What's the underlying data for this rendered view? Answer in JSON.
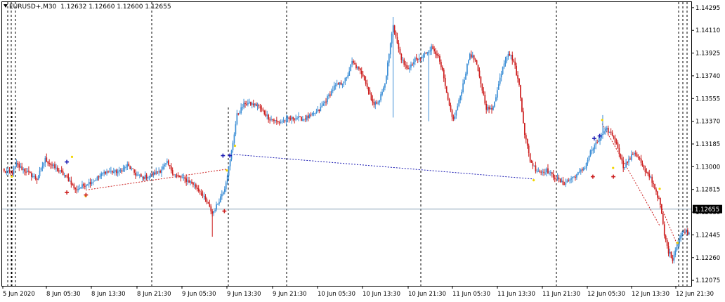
{
  "header": {
    "symbol": "EURUSD+,M30",
    "ohlc": "1.12632 1.12660 1.12600 1.12655"
  },
  "colors": {
    "bull": "#3d8fd6",
    "bear": "#cc1f1f",
    "grid": "#000000",
    "bid_line": "#8aa3b8",
    "price_box": "#000000",
    "price_box_text": "#ffffff",
    "marker_yellow": "#f2d600",
    "arrow_blue": "#1b1bb3",
    "arrow_red": "#cc1f1f"
  },
  "chart_data": {
    "type": "candlestick",
    "price_ticks": [
      "1.14295",
      "1.14110",
      "1.13925",
      "1.13740",
      "1.13555",
      "1.13370",
      "1.13185",
      "1.13000",
      "1.12815",
      "1.12630",
      "1.12445",
      "1.12260",
      "1.12075"
    ],
    "price_range": [
      1.1203,
      1.1434
    ],
    "current_price": "1.12655",
    "time_ticks": [
      "5 Jun 2020",
      "8 Jun 05:30",
      "8 Jun 13:30",
      "8 Jun 21:30",
      "9 Jun 05:30",
      "9 Jun 13:30",
      "9 Jun 21:30",
      "10 Jun 05:30",
      "10 Jun 13:30",
      "10 Jun 21:30",
      "11 Jun 05:30",
      "11 Jun 13:30",
      "11 Jun 21:30",
      "12 Jun 05:30",
      "12 Jun 13:30",
      "12 Jun 21:30"
    ],
    "close_anchors": [
      [
        0,
        1.1296
      ],
      [
        6,
        1.1295
      ],
      [
        9,
        1.1302
      ],
      [
        11,
        1.13
      ],
      [
        15,
        1.1297
      ],
      [
        24,
        1.129
      ],
      [
        30,
        1.1306
      ],
      [
        36,
        1.13
      ],
      [
        44,
        1.1293
      ],
      [
        49,
        1.1287
      ],
      [
        52,
        1.1281
      ],
      [
        60,
        1.1286
      ],
      [
        66,
        1.1289
      ],
      [
        74,
        1.1296
      ],
      [
        84,
        1.1296
      ],
      [
        90,
        1.1301
      ],
      [
        96,
        1.1294
      ],
      [
        101,
        1.1291
      ],
      [
        107,
        1.1293
      ],
      [
        114,
        1.1297
      ],
      [
        119,
        1.1303
      ],
      [
        124,
        1.1294
      ],
      [
        131,
        1.129
      ],
      [
        137,
        1.1287
      ],
      [
        143,
        1.128
      ],
      [
        148,
        1.1271
      ],
      [
        152,
        1.1262
      ],
      [
        155,
        1.1268
      ],
      [
        161,
        1.1283
      ],
      [
        165,
        1.1305
      ],
      [
        170,
        1.1342
      ],
      [
        176,
        1.1352
      ],
      [
        185,
        1.135
      ],
      [
        193,
        1.134
      ],
      [
        200,
        1.1336
      ],
      [
        206,
        1.1338
      ],
      [
        212,
        1.134
      ],
      [
        218,
        1.1339
      ],
      [
        224,
        1.1341
      ],
      [
        230,
        1.1346
      ],
      [
        236,
        1.1356
      ],
      [
        241,
        1.1365
      ],
      [
        246,
        1.1368
      ],
      [
        250,
        1.1372
      ],
      [
        254,
        1.1385
      ],
      [
        258,
        1.138
      ],
      [
        262,
        1.1375
      ],
      [
        266,
        1.1362
      ],
      [
        270,
        1.135
      ],
      [
        274,
        1.1355
      ],
      [
        278,
        1.1367
      ],
      [
        281,
        1.1392
      ],
      [
        284,
        1.1416
      ],
      [
        288,
        1.1395
      ],
      [
        292,
        1.1382
      ],
      [
        296,
        1.138
      ],
      [
        300,
        1.1387
      ],
      [
        304,
        1.1388
      ],
      [
        308,
        1.1393
      ],
      [
        312,
        1.1397
      ],
      [
        316,
        1.1392
      ],
      [
        320,
        1.1377
      ],
      [
        324,
        1.1353
      ],
      [
        328,
        1.1338
      ],
      [
        332,
        1.1353
      ],
      [
        336,
        1.1372
      ],
      [
        340,
        1.1392
      ],
      [
        344,
        1.1386
      ],
      [
        348,
        1.1368
      ],
      [
        352,
        1.1348
      ],
      [
        356,
        1.1346
      ],
      [
        360,
        1.1362
      ],
      [
        364,
        1.1382
      ],
      [
        368,
        1.1393
      ],
      [
        372,
        1.1386
      ],
      [
        376,
        1.1366
      ],
      [
        380,
        1.1327
      ],
      [
        384,
        1.1305
      ],
      [
        388,
        1.1298
      ],
      [
        392,
        1.1296
      ],
      [
        396,
        1.1297
      ],
      [
        400,
        1.1293
      ],
      [
        404,
        1.129
      ],
      [
        408,
        1.1286
      ],
      [
        412,
        1.1289
      ],
      [
        416,
        1.1292
      ],
      [
        420,
        1.1295
      ],
      [
        424,
        1.13
      ],
      [
        428,
        1.1312
      ],
      [
        432,
        1.1318
      ],
      [
        436,
        1.1325
      ],
      [
        440,
        1.133
      ],
      [
        444,
        1.1326
      ],
      [
        448,
        1.1316
      ],
      [
        452,
        1.13
      ],
      [
        456,
        1.1305
      ],
      [
        460,
        1.1312
      ],
      [
        464,
        1.1306
      ],
      [
        468,
        1.1295
      ],
      [
        472,
        1.1291
      ],
      [
        476,
        1.128
      ],
      [
        479,
        1.1269
      ],
      [
        482,
        1.1244
      ],
      [
        485,
        1.1231
      ],
      [
        488,
        1.1225
      ],
      [
        491,
        1.1236
      ],
      [
        494,
        1.1244
      ],
      [
        497,
        1.1248
      ],
      [
        500,
        1.1246
      ]
    ],
    "separators": [
      "5 Jun 2020",
      "8 Jun 05:30",
      "8 Jun 13:30",
      "8 Jun 21:30",
      "9 Jun 13:30",
      "10 Jun 21:30",
      "11 Jun 21:30",
      "12 Jun 21:30"
    ],
    "trend_lines": [
      {
        "color": "red",
        "from": [
          60,
          1.1281
        ],
        "to": [
          163,
          1.1298
        ]
      },
      {
        "color": "navy",
        "from": [
          168,
          1.131
        ],
        "to": [
          387,
          1.129
        ]
      },
      {
        "color": "red",
        "from": [
          437,
          1.1335
        ],
        "to": [
          479,
          1.1252
        ]
      },
      {
        "color": "red",
        "from": [
          479,
          1.127
        ],
        "to": [
          492,
          1.1236
        ]
      }
    ]
  }
}
